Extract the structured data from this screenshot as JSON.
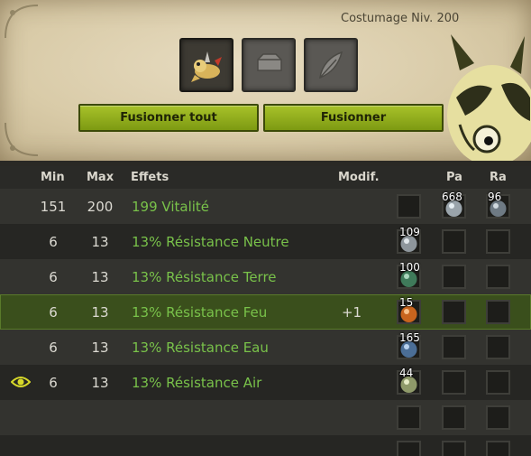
{
  "header": {
    "level_label": "Costumage Niv. 200",
    "slots": [
      {
        "icon": "creature-rune-icon",
        "active": true
      },
      {
        "icon": "stone-icon",
        "active": false
      },
      {
        "icon": "feather-icon",
        "active": false
      }
    ],
    "buttons": {
      "fuse_all": "Fusionner tout",
      "fuse": "Fusionner"
    }
  },
  "table": {
    "columns": {
      "min": "Min",
      "max": "Max",
      "effects": "Effets",
      "modif": "Modif.",
      "pa": "Pa",
      "ra": "Ra"
    },
    "rows": [
      {
        "min": "151",
        "max": "200",
        "effect": "199 Vitalité",
        "modif": "",
        "rune_a": "",
        "rune_pa": "668",
        "rune_ra": "96",
        "eye": false
      },
      {
        "min": "6",
        "max": "13",
        "effect": "13% Résistance Neutre",
        "modif": "",
        "rune_a": "109",
        "rune_pa": "",
        "rune_ra": "",
        "eye": false
      },
      {
        "min": "6",
        "max": "13",
        "effect": "13% Résistance Terre",
        "modif": "",
        "rune_a": "100",
        "rune_pa": "",
        "rune_ra": "",
        "eye": false
      },
      {
        "min": "6",
        "max": "13",
        "effect": "13% Résistance Feu",
        "modif": "+1",
        "rune_a": "15",
        "rune_pa": "",
        "rune_ra": "",
        "eye": false,
        "selected": true
      },
      {
        "min": "6",
        "max": "13",
        "effect": "13% Résistance Eau",
        "modif": "",
        "rune_a": "165",
        "rune_pa": "",
        "rune_ra": "",
        "eye": false
      },
      {
        "min": "6",
        "max": "13",
        "effect": "13% Résistance Air",
        "modif": "",
        "rune_a": "44",
        "rune_pa": "",
        "rune_ra": "",
        "eye": true
      }
    ]
  },
  "colors": {
    "effect_text": "#79c24a",
    "button_green": "#8fae1c",
    "selected_row": "#3a4f1c"
  }
}
